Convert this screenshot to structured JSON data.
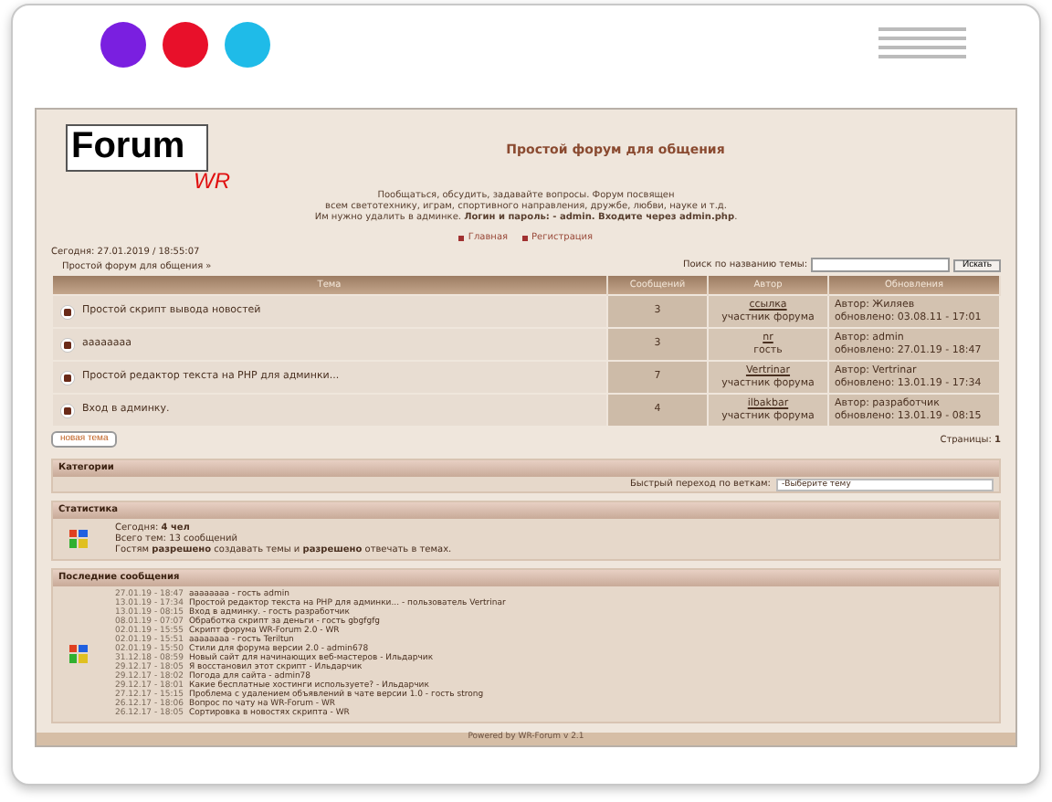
{
  "window": {
    "dots": [
      {
        "color": "#7a1fe0"
      },
      {
        "color": "#e8102a"
      },
      {
        "color": "#1fbbe8"
      }
    ]
  },
  "forum": {
    "logo": {
      "text": "Forum",
      "suffix": "WR"
    },
    "title": "Простой форум для общения",
    "description": [
      "Пообщаться, обсудить, задавайте вопросы. Форум посвящен",
      "всем светотехнику, играм, спортивного направления, дружбе, любви, науке и т.д.",
      "Им нужно удалить в админке. **Логин и пароль: - admin. Входите через admin.php**."
    ],
    "nav": [
      "Главная",
      "Регистрация"
    ],
    "date": "Сегодня: 27.01.2019 / 18:55:07",
    "breadcrumb": "Простой форум для общения »",
    "search": {
      "label": "Поиск по названию темы:",
      "button": "Искать"
    },
    "table": {
      "columns": [
        "Тема",
        "Сообщений",
        "Автор",
        "Обновления"
      ],
      "rows": [
        {
          "topic": "Простой скрипт вывода новостей",
          "posts": "3",
          "author": "ссылка",
          "role": "участник форума",
          "updated_by": "Автор: Жиляев",
          "updated": "обновлено: 03.08.11 - 17:01"
        },
        {
          "topic": "аааааааа",
          "posts": "3",
          "author": "nr",
          "role": "гость",
          "updated_by": "Автор: admin",
          "updated": "обновлено: 27.01.19 - 18:47"
        },
        {
          "topic": "Простой редактор текста на PHP для админки...",
          "posts": "7",
          "author": "Vertrinar",
          "role": "участник форума",
          "updated_by": "Автор: Vertrinar",
          "updated": "обновлено: 13.01.19 - 17:34"
        },
        {
          "topic": "Вход в админку.",
          "posts": "4",
          "author": "ilbakbar",
          "role": "участник форума",
          "updated_by": "Автор: разработчик",
          "updated": "обновлено: 13.01.19 - 08:15"
        }
      ]
    },
    "new_topic_button": "новая тема",
    "pages": {
      "label": "Страницы:",
      "current": "1"
    },
    "categories": {
      "title": "Категории",
      "jump_label": "Быстрый переход по веткам:",
      "jump_value": "-Выберите тему"
    },
    "stats": {
      "title": "Статистика",
      "lines": [
        "Сегодня: **4 чел**",
        "Всего тем: 13 сообщений",
        "Гостям **разрешено** создавать темы и **разрешено** отвечать в темах."
      ]
    },
    "recent": {
      "title": "Последние сообщения",
      "items": [
        {
          "time": "27.01.19 - 18:47",
          "text": "аааааааа - гость admin"
        },
        {
          "time": "13.01.19 - 17:34",
          "text": "Простой редактор текста на PHP для админки... - пользователь Vertrinar"
        },
        {
          "time": "13.01.19 - 08:15",
          "text": "Вход в админку. - гость разработчик"
        },
        {
          "time": "08.01.19 - 07:07",
          "text": "Обработка скрипт за деньги - гость gbgfgfg"
        },
        {
          "time": "02.01.19 - 15:55",
          "text": "Скрипт форума WR-Forum 2.0 - WR"
        },
        {
          "time": "02.01.19 - 15:51",
          "text": "аааааааа - гость Teriltun"
        },
        {
          "time": "02.01.19 - 15:50",
          "text": "Стили для форума версии 2.0 - admin678"
        },
        {
          "time": "31.12.18 - 08:59",
          "text": "Новый сайт для начинающих веб-мастеров - Ильдарчик"
        },
        {
          "time": "29.12.17 - 18:05",
          "text": "Я восстановил этот скрипт - Ильдарчик"
        },
        {
          "time": "29.12.17 - 18:02",
          "text": "Погода для сайта - admin78"
        },
        {
          "time": "29.12.17 - 18:01",
          "text": "Какие бесплатные хостинги используете? - Ильдарчик"
        },
        {
          "time": "27.12.17 - 15:15",
          "text": "Проблема с удалением объявлений в чате версии 1.0 - гость strong"
        },
        {
          "time": "26.12.17 - 18:06",
          "text": "Вопрос по чату на WR-Forum - WR"
        },
        {
          "time": "26.12.17 - 18:05",
          "text": "Сортировка в новостях скрипта - WR"
        }
      ]
    },
    "footer": "Powered by WR-Forum v 2.1"
  }
}
